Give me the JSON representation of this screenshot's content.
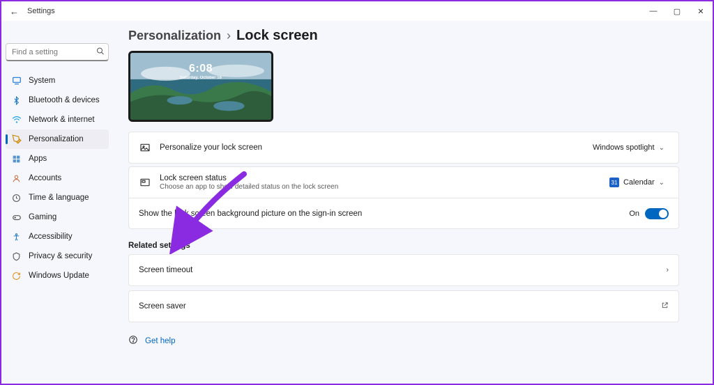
{
  "window": {
    "back_icon": "←",
    "title": "Settings",
    "min": "—",
    "max": "▢",
    "close": "✕"
  },
  "sidebar": {
    "search_placeholder": "Find a setting",
    "items": [
      {
        "label": "System",
        "icon": "system"
      },
      {
        "label": "Bluetooth & devices",
        "icon": "bluetooth"
      },
      {
        "label": "Network & internet",
        "icon": "wifi"
      },
      {
        "label": "Personalization",
        "icon": "personalization",
        "active": true
      },
      {
        "label": "Apps",
        "icon": "apps"
      },
      {
        "label": "Accounts",
        "icon": "accounts"
      },
      {
        "label": "Time & language",
        "icon": "time"
      },
      {
        "label": "Gaming",
        "icon": "gaming"
      },
      {
        "label": "Accessibility",
        "icon": "accessibility"
      },
      {
        "label": "Privacy & security",
        "icon": "privacy"
      },
      {
        "label": "Windows Update",
        "icon": "update"
      }
    ]
  },
  "breadcrumb": {
    "parent": "Personalization",
    "sep": "›",
    "current": "Lock screen"
  },
  "preview": {
    "time": "6:08",
    "date": "Saturday, October 16"
  },
  "rows": {
    "personalize": {
      "title": "Personalize your lock screen",
      "dropdown": "Windows spotlight"
    },
    "status": {
      "title": "Lock screen status",
      "subtitle": "Choose an app to show detailed status on the lock screen",
      "dropdown": "Calendar"
    },
    "signin": {
      "title": "Show the lock screen background picture on the sign-in screen",
      "state": "On"
    }
  },
  "related": {
    "heading": "Related settings",
    "timeout": "Screen timeout",
    "saver": "Screen saver"
  },
  "help": {
    "label": "Get help"
  }
}
